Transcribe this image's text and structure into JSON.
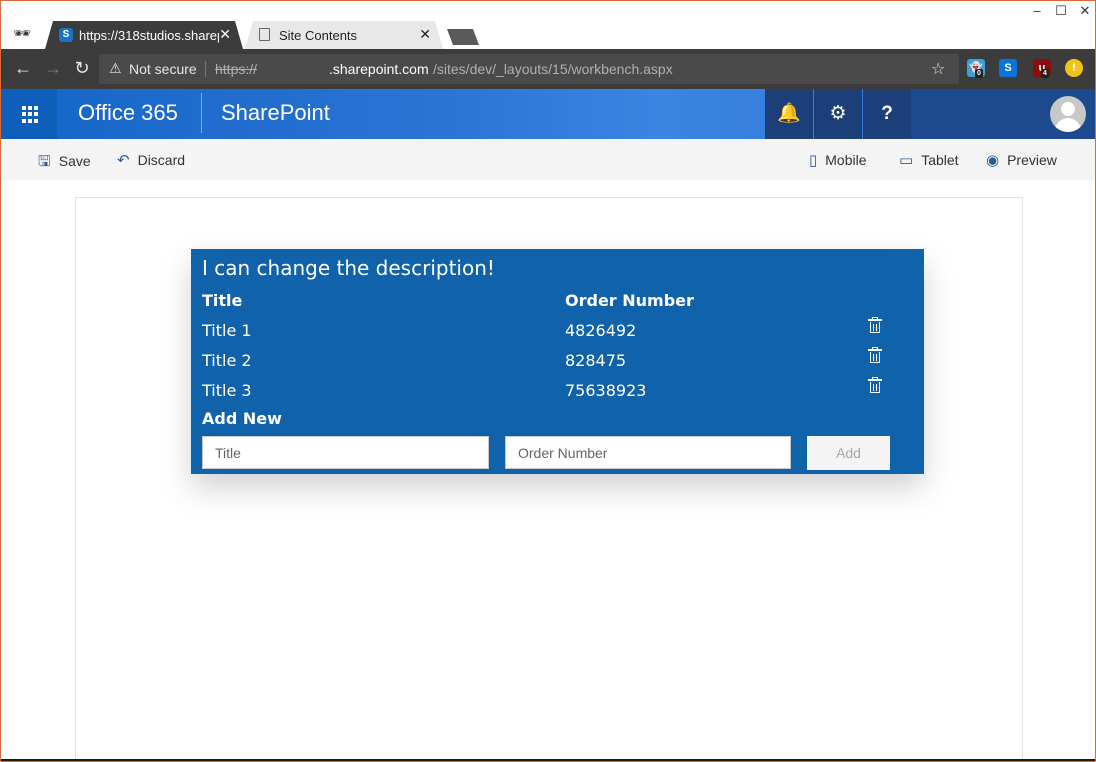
{
  "browser": {
    "tabs": [
      {
        "label": "https://318studios.sharep",
        "favicon": "S",
        "active": true
      },
      {
        "label": "Site Contents",
        "favicon": "page-icon",
        "active": false
      }
    ],
    "tab_close": "✕",
    "window_controls": [
      "–",
      "☐",
      "✕"
    ],
    "security_label": "Not secure",
    "url_scheme": "https://",
    "url_host": ".sharepoint.com",
    "url_path": "/sites/dev/_layouts/15/workbench.aspx",
    "extensions": [
      {
        "name": "ghostery-icon",
        "badge": "0",
        "color": "#3aa0d8"
      },
      {
        "name": "skype-icon",
        "badge": "",
        "color": "#0a74d8"
      },
      {
        "name": "ublock-icon",
        "badge": "4",
        "color": "#8b0d0d"
      },
      {
        "name": "notification-icon",
        "badge": "",
        "color": "#f0c419"
      }
    ]
  },
  "suitebar": {
    "brand": "Office 365",
    "product": "SharePoint",
    "icons": [
      "bell-icon",
      "gear-icon",
      "help-icon"
    ]
  },
  "commandbar": {
    "save": "Save",
    "discard": "Discard",
    "mobile": "Mobile",
    "tablet": "Tablet",
    "preview": "Preview"
  },
  "webpart": {
    "description": "I can change the description!",
    "headers": {
      "title": "Title",
      "order": "Order Number"
    },
    "rows": [
      {
        "title": "Title 1",
        "order": "4826492"
      },
      {
        "title": "Title 2",
        "order": "828475"
      },
      {
        "title": "Title 3",
        "order": "75638923"
      }
    ],
    "add_new_label": "Add New",
    "title_placeholder": "Title",
    "order_placeholder": "Order Number",
    "add_button": "Add",
    "colors": {
      "background": "#1062ab",
      "text": "#ffffff"
    }
  }
}
